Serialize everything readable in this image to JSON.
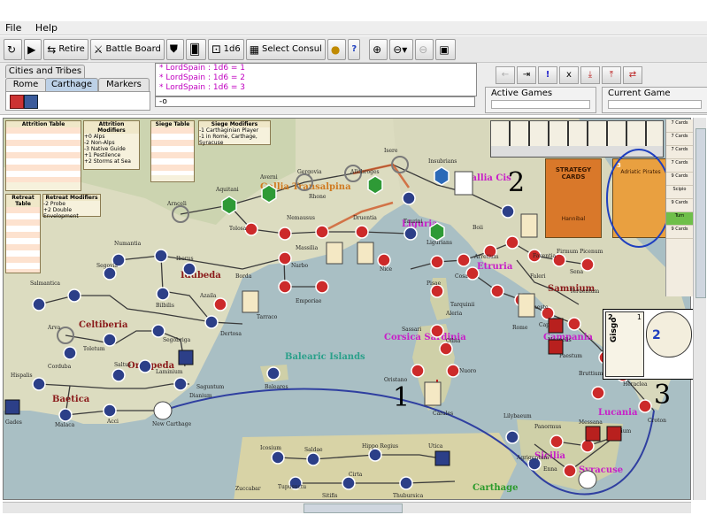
{
  "menu": {
    "file": "File",
    "help": "Help"
  },
  "toolbar": {
    "retire": "Retire",
    "battle_board": "Battle Board",
    "dice": "1d6",
    "select_consul": "Select Consul",
    "help_q": "?"
  },
  "tabs": {
    "cities_tribes": "Cities and Tribes",
    "rome": "Rome",
    "carthage": "Carthage",
    "markers": "Markers"
  },
  "log": {
    "lines": [
      "* LordSpain : 1d6 = 1",
      "* LordSpain : 1d6 = 2",
      "* LordSpain : 1d6 = 3"
    ],
    "input_value": "-o"
  },
  "panels": {
    "active_games": "Active Games",
    "current_game": "Current Game"
  },
  "map": {
    "regions": {
      "gallia_transalpina": "Gallia Transalpina",
      "gallia_cis": "Gallia Cis",
      "liguria": "Liguria",
      "idubeda": "Idubeda",
      "celtiberia": "Celtiberia",
      "orospeda": "Orospeda",
      "baetica": "Baetica",
      "balearic": "Balearic Islands",
      "corsica": "Corsica Sardinia",
      "etruria": "Etruria",
      "samnium": "Samnium",
      "campania": "Campania",
      "lucania": "Lucania",
      "sicilia": "Sicilia",
      "syracuse": "Syracuse",
      "carthage": "Carthage"
    },
    "cities": {
      "massilia": "Massilia",
      "gergovia": "Gergovia",
      "allobroges": "Allobroges",
      "isere": "Isere",
      "insubrians": "Insubrians",
      "aquitani": "Aquitani",
      "averni": "Averni",
      "rhone": "Rhone",
      "arnceli": "Arnceli",
      "tolosa": "Tolosa",
      "nemausus": "Nemausus",
      "druentia": "Druentia",
      "taurini": "Taurini",
      "narbo": "Narbo",
      "nice": "Nice",
      "ligurians": "Ligurians",
      "boii": "Boii",
      "numantia": "Numantia",
      "iberus": "Iberus",
      "salmantica": "Salmantica",
      "segovia": "Segovia",
      "bilbilis": "Bilbilis",
      "azaila": "Azaila",
      "borda": "Borda",
      "tarraco": "Tarraco",
      "emporiae": "Emporiae",
      "arva": "Arva",
      "toletum": "Toletum",
      "segobriga": "Segobriga",
      "dertosa": "Dertosa",
      "saguntum": "Saguntum",
      "cordoba": "Corduba",
      "saltus": "Saltus",
      "laminium": "Laminium",
      "hispalis": "Hispalis",
      "dianium": "Dianium",
      "gades": "Gades",
      "malaca": "Malaca",
      "acci": "Acci",
      "new_carthage": "New Carthage",
      "baleares": "Baleares",
      "pisae": "Pisae",
      "cosa": "Cosa",
      "tarquinii": "Tarquinii",
      "aleria": "Aleria",
      "sassari": "Sassari",
      "olbia": "Olbia",
      "oristano": "Oristano",
      "nuoro": "Nuoro",
      "carales": "Carales",
      "rome": "Rome",
      "arretium": "Arretium",
      "faventia": "Faventia",
      "firmum": "Firmum Picenum",
      "sena": "Sena",
      "faleri": "Faleri",
      "praeneste": "Praeneste",
      "teruentum": "Teruentum",
      "capua": "Capua",
      "neapolis": "Neapolis",
      "paestum": "Paestum",
      "bruttium": "Bruttium",
      "heraclea": "Heraclea",
      "tarentum": "Tarentum",
      "croton": "Croton",
      "messana": "Messana",
      "rhegium": "Rhegium",
      "lilybaeum": "Lilybaeum",
      "panormus": "Panormus",
      "agrigentum": "Agrigentum",
      "enna": "Enna",
      "icosium": "Icosium",
      "saldae": "Saldae",
      "hippo_regius": "Hippo Regius",
      "utica": "Utica",
      "zuccabar": "Zuccabar",
      "tupusuctu": "Tupusuctu",
      "sitifis": "Sitifis",
      "cirta": "Cirta",
      "thubursica": "Thubursica"
    },
    "markers": {
      "one": "1",
      "two": "2",
      "three": "3"
    }
  },
  "tables": {
    "attrition": "Attrition Table",
    "attrition_mod": "Attrition Modifiers",
    "attrition_mod_lines": [
      "+0 Alps",
      "-2 Non-Alps",
      "-3 Native Guide",
      "+1 Pestilence",
      "+2 Storms at Sea"
    ],
    "siege": "Siege Table",
    "siege_mod": "Siege Modifiers",
    "siege_mod_lines": [
      "-1 Carthaginian Player",
      "-1 in Rome, Carthage, Syracuse"
    ],
    "retreat": "Retreat Table",
    "retreat_mod": "Retreat Modifiers",
    "retreat_mod_lines": [
      "-2 Probe",
      "+2 Double Envelopment"
    ]
  },
  "cards": {
    "strategy": "STRATEGY CARDS",
    "hannibal": "Hannibal",
    "adriatic": "Adriatic Pirates",
    "adriatic_num": "3"
  },
  "sidebar": [
    "7 Cards",
    "7 Cards",
    "7 Cards",
    "7 Cards",
    "9 Cards",
    "Scipio",
    "9 Cards",
    "Turn",
    "9 Cards"
  ],
  "gisgo": {
    "name": "Gisgo",
    "top_left": "2",
    "top_right": "1",
    "rating": "2"
  },
  "colors": {
    "roman_red": "#cc2a2a",
    "carthage_blue": "#2c3f88",
    "neutral_green": "#2e9a36"
  }
}
